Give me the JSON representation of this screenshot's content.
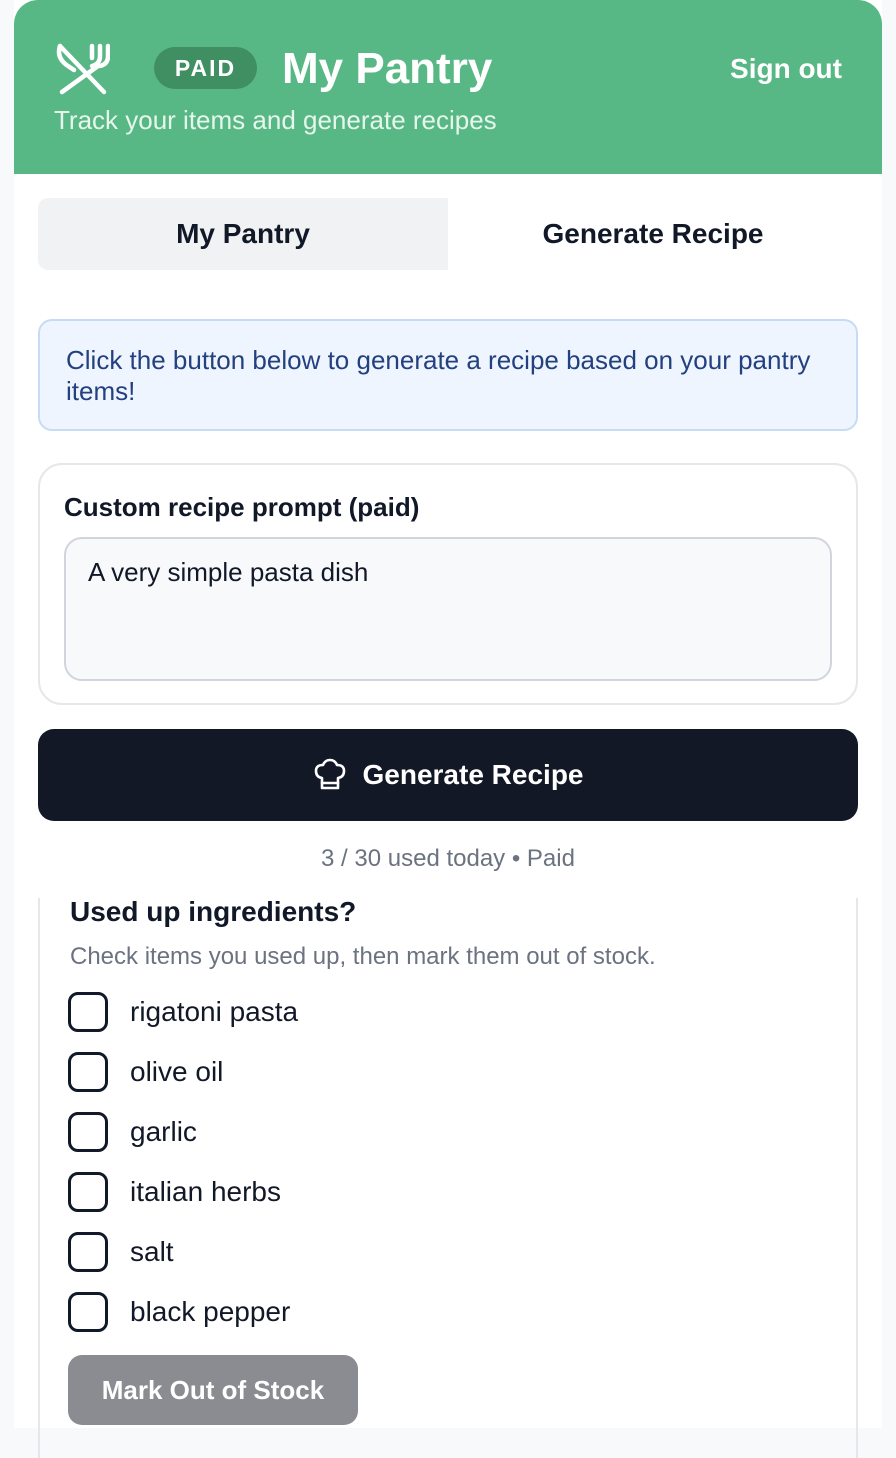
{
  "header": {
    "icon": "utensils-crossed-icon",
    "badge": "PAID",
    "title": "My Pantry",
    "subtitle": "Track your items and generate recipes",
    "sign_out": "Sign out",
    "bg_color": "#58b885"
  },
  "tabs": [
    {
      "label": "My Pantry",
      "active": true
    },
    {
      "label": "Generate Recipe",
      "active": false
    }
  ],
  "info": {
    "text": "Click the button below to generate a recipe based on your pantry items!"
  },
  "prompt": {
    "label": "Custom recipe prompt (paid)",
    "value": "A very simple pasta dish"
  },
  "generate": {
    "icon": "chef-hat-icon",
    "label": "Generate Recipe",
    "usage": "3 / 30 used today • Paid"
  },
  "used_up": {
    "title": "Used up ingredients?",
    "hint": "Check items you used up, then mark them out of stock.",
    "items": [
      {
        "label": "rigatoni pasta",
        "checked": false
      },
      {
        "label": "olive oil",
        "checked": false
      },
      {
        "label": "garlic",
        "checked": false
      },
      {
        "label": "italian herbs",
        "checked": false
      },
      {
        "label": "salt",
        "checked": false
      },
      {
        "label": "black pepper",
        "checked": false
      }
    ],
    "button": "Mark Out of Stock"
  }
}
